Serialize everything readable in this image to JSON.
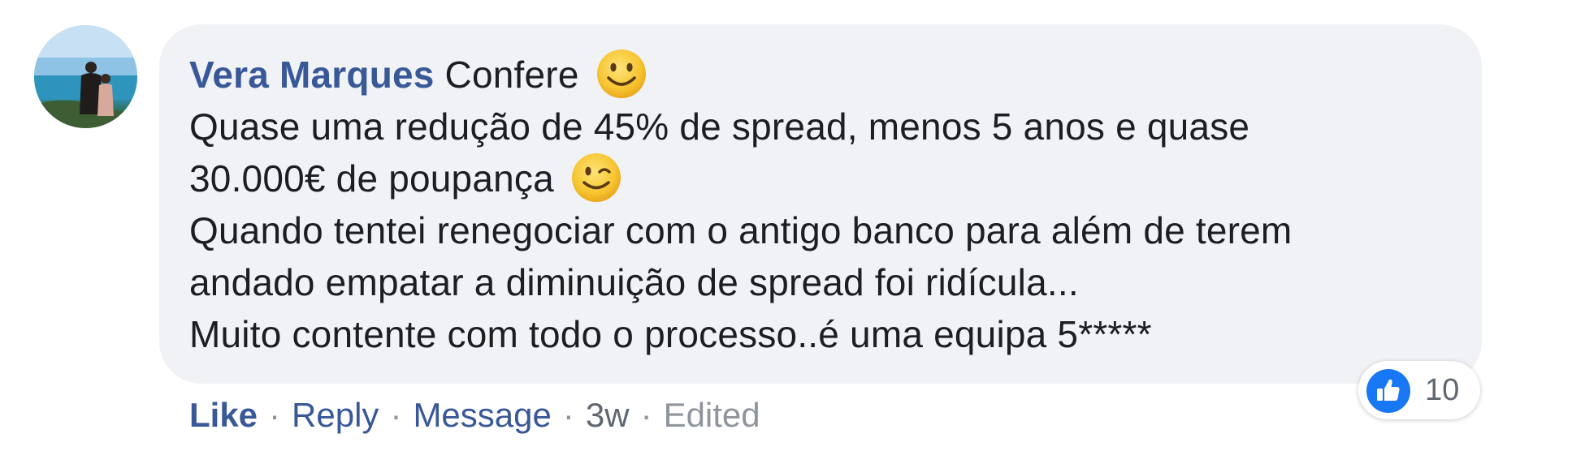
{
  "comment": {
    "author": "Vera Marques",
    "first_line_text": "Confere",
    "line2": "Quase uma redução de 45% de spread, menos 5 anos e quase",
    "line3": "30.000€ de poupança",
    "line4": "Quando tentei renegociar com o antigo banco para além de terem",
    "line5": "andado empatar a diminuição de spread foi ridícula...",
    "line6": "Muito contente com todo o processo..é uma equipa 5*****",
    "emoji_1": "smiling-face-emoji",
    "emoji_2": "winking-face-emoji"
  },
  "reactions": {
    "icon": "like-thumbs-up-icon",
    "count": "10"
  },
  "actions": {
    "like": "Like",
    "reply": "Reply",
    "message": "Message",
    "separator": "·",
    "time": "3w",
    "edited": "Edited"
  },
  "colors": {
    "author": "#385898",
    "bubble": "#f0f2f5",
    "like_badge": "#1877f2"
  }
}
